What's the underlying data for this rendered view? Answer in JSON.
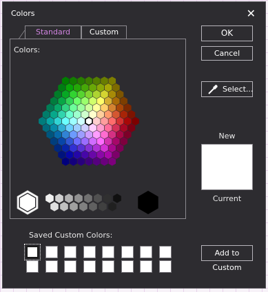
{
  "dialog": {
    "title": "Colors",
    "close_glyph": "✕"
  },
  "tabs": [
    {
      "label": "Standard",
      "active": true
    },
    {
      "label": "Custom",
      "active": false
    }
  ],
  "panel": {
    "colors_label": "Colors:"
  },
  "buttons": {
    "ok": "OK",
    "cancel": "Cancel",
    "select": "Select...",
    "select_icon": "eyedropper-icon",
    "add_to_custom": "Add to Custom"
  },
  "preview": {
    "new_label": "New",
    "current_label": "Current",
    "new_color": "#ffffff",
    "current_color": "#ffffff"
  },
  "saved": {
    "label": "Saved Custom Colors:",
    "swatches": [
      "#ffffff",
      "#ffffff",
      "#ffffff",
      "#ffffff",
      "#ffffff",
      "#ffffff",
      "#ffffff",
      "#ffffff",
      "#ffffff",
      "#ffffff",
      "#ffffff",
      "#ffffff",
      "#ffffff",
      "#ffffff",
      "#ffffff",
      "#ffffff"
    ]
  },
  "palette": {
    "selected_color": "#ffffff",
    "gray_selected": "#ffffff",
    "grays": [
      "#ffffff",
      "#f0f0f0",
      "#e0e0e0",
      "#d0d0d0",
      "#c0c0c0",
      "#b0b0b0",
      "#a0a0a0",
      "#909090",
      "#808080",
      "#707070",
      "#606060",
      "#505050",
      "#404040",
      "#303030",
      "#202020",
      "#101010",
      "#000000"
    ]
  }
}
